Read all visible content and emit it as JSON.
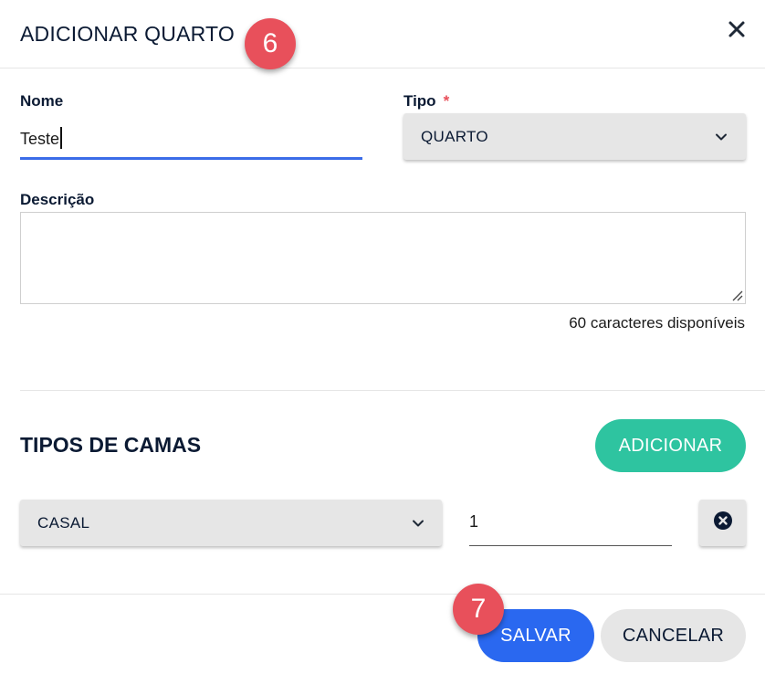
{
  "dialog": {
    "title": "ADICIONAR QUARTO",
    "close_icon": "close-icon"
  },
  "markers": {
    "step_6": "6",
    "step_7": "7"
  },
  "form": {
    "name_label": "Nome",
    "name_value": "Teste",
    "type_label": "Tipo",
    "type_required_mark": "*",
    "type_value": "QUARTO",
    "description_label": "Descrição",
    "description_value": "",
    "counter_text": "60 caracteres disponíveis"
  },
  "beds": {
    "section_title": "TIPOS DE CAMAS",
    "add_label": "ADICIONAR",
    "rows": [
      {
        "type": "CASAL",
        "quantity": "1",
        "remove_icon": "remove-circle-icon"
      }
    ]
  },
  "footer": {
    "save_label": "SALVAR",
    "cancel_label": "CANCELAR"
  },
  "colors": {
    "accent_blue": "#2a68f0",
    "add_green": "#2ec4a0",
    "marker_red": "#e8505b",
    "required_red": "#e8505b",
    "text_navy": "#0b1a33"
  }
}
